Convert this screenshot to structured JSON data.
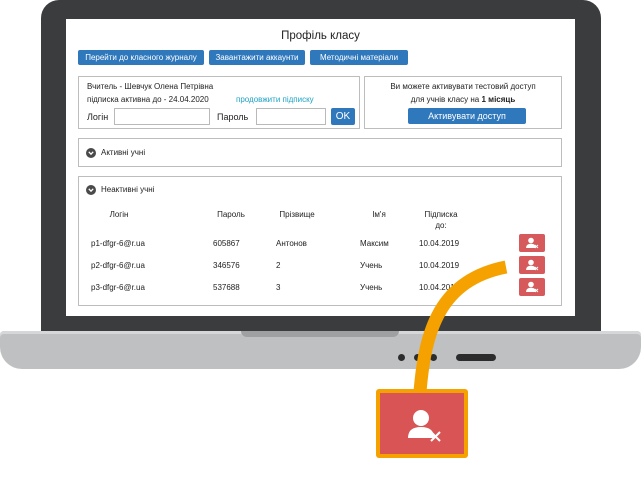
{
  "page": {
    "title": "Профіль класу",
    "nav": [
      "Перейти до класного журналу",
      "Завантажити аккаунти",
      "Методичні матеріали"
    ]
  },
  "teacher": {
    "name_line": "Вчитель - Шевчук Олена Петрівна",
    "subscription_line": "підписка активна до - 24.04.2020",
    "extend_link": "продовжити підписку",
    "login_label": "Логін",
    "login_value": "",
    "password_label": "Пароль",
    "password_value": "",
    "ok_label": "OK"
  },
  "trial": {
    "line1": "Ви можете активувати тестовий доступ",
    "line2_pre": "для учнів класу на ",
    "line2_bold": "1 місяць",
    "button": "Активувати доступ"
  },
  "sections": {
    "active": "Активні учні",
    "inactive": "Неактивні учні"
  },
  "table": {
    "headers": [
      "Логін",
      "Пароль",
      "Прізвище",
      "Ім'я",
      "Підписка до:"
    ],
    "rows": [
      [
        "p1-dfgr-6@r.ua",
        "605867",
        "Антонов",
        "Максим",
        "10.04.2019"
      ],
      [
        "p2-dfgr-6@r.ua",
        "346576",
        "2",
        "Учень",
        "10.04.2019"
      ],
      [
        "p3-dfgr-6@r.ua",
        "537688",
        "3",
        "Учень",
        "10.04.2019"
      ]
    ]
  },
  "icons": {
    "delete": "user-remove-icon",
    "toggle": "chevron-down-icon"
  },
  "colors": {
    "primary": "#2f78bc",
    "danger": "#d65a5c",
    "link": "#1fa3c4",
    "callout_border": "#f5a200",
    "laptop": "#3b3c3e"
  }
}
